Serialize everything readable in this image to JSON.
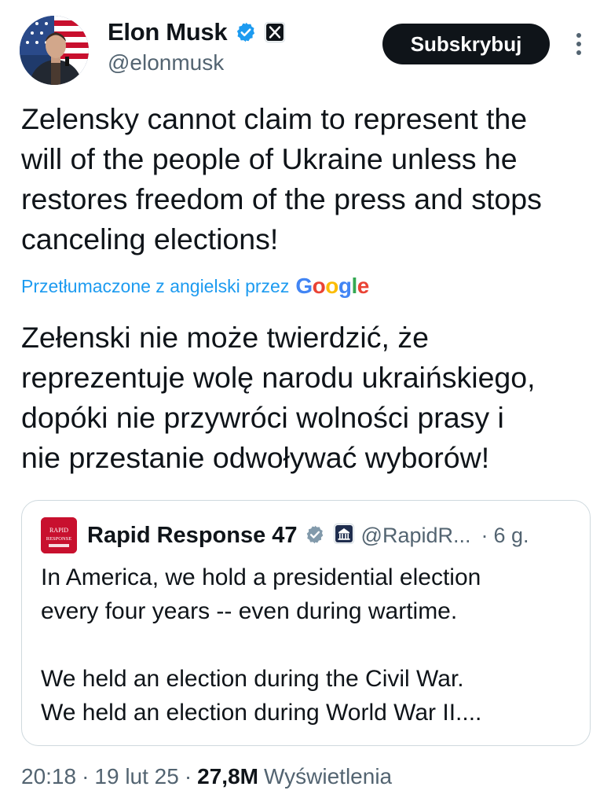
{
  "author": {
    "display_name": "Elon Musk",
    "handle": "@elonmusk",
    "verified": true,
    "affiliation_badge": "x-logo-icon"
  },
  "actions": {
    "subscribe_label": "Subskrybuj",
    "more_icon": "more-vertical-icon"
  },
  "tweet": {
    "text": "Zelensky cannot claim to represent the\nwill of the people of Ukraine unless he\nrestores freedom of the press and stops\ncanceling elections!",
    "translation_label": "Przetłumaczone z angielski przez",
    "translation_provider": "Google",
    "translated_text": "Zełenski nie może twierdzić, że\nreprezentuje wolę narodu ukraińskiego,\ndopóki nie przywróci wolności prasy i\nnie przestanie odwoływać wyborów!"
  },
  "quote": {
    "avatar_text": "RAPID RESPONSE",
    "display_name": "Rapid Response 47",
    "verified": true,
    "affiliation_badge": "white-house-icon",
    "handle": "@RapidR...",
    "separator": "·",
    "time": "6 g.",
    "text": "In America, we hold a presidential election\nevery four years -- even during wartime.\n\nWe held an election during the Civil War.\nWe held an election during World War II...."
  },
  "meta": {
    "time": "20:18",
    "date": "19 lut 25",
    "views_count": "27,8M",
    "views_label": "Wyświetlenia"
  },
  "colors": {
    "text_primary": "#0f1419",
    "text_secondary": "#536471",
    "link_blue": "#1d9bf0",
    "verified_blue": "#1d9bf0",
    "card_border": "#cfd9de",
    "button_bg": "#0f1419"
  }
}
